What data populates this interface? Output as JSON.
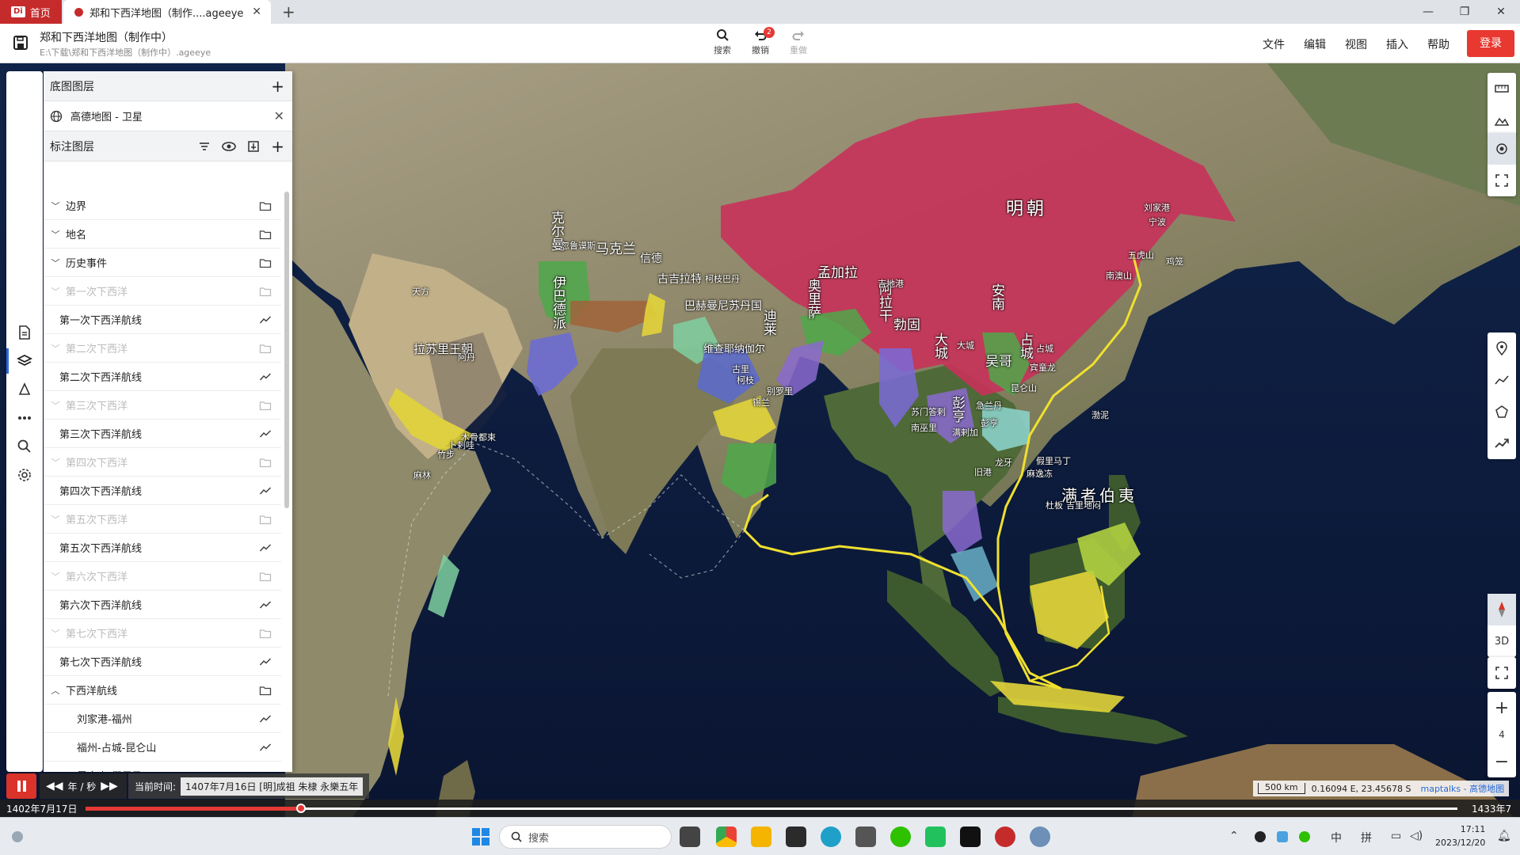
{
  "tabs": {
    "home_label": "首页",
    "home_logo": "Di",
    "doc_label": "郑和下西洋地图（制作....ageeye"
  },
  "app": {
    "title": "郑和下西洋地图（制作中）",
    "path": "E:\\下载\\郑和下西洋地图（制作中）.ageeye",
    "tools": {
      "search": "搜索",
      "undo": "撤销",
      "undo_badge": "2",
      "redo": "重做"
    },
    "menu": [
      "文件",
      "编辑",
      "视图",
      "插入",
      "帮助"
    ],
    "login": "登录"
  },
  "panel": {
    "basemap_header": "底图图层",
    "basemap_item": "高德地图 - 卫星",
    "annot_header": "标注图层",
    "layers": [
      {
        "label": "边界",
        "kind": "folder",
        "level": 0,
        "muted": false,
        "chev": "down"
      },
      {
        "label": "地名",
        "kind": "folder",
        "level": 0,
        "muted": false,
        "chev": "down"
      },
      {
        "label": "历史事件",
        "kind": "folder",
        "level": 0,
        "muted": false,
        "chev": "down"
      },
      {
        "label": "第一次下西洋",
        "kind": "folder",
        "level": 0,
        "muted": true,
        "chev": "down"
      },
      {
        "label": "第一次下西洋航线",
        "kind": "line",
        "level": 1,
        "muted": false,
        "chev": ""
      },
      {
        "label": "第二次下西洋",
        "kind": "folder",
        "level": 0,
        "muted": true,
        "chev": "down"
      },
      {
        "label": "第二次下西洋航线",
        "kind": "line",
        "level": 1,
        "muted": false,
        "chev": ""
      },
      {
        "label": "第三次下西洋",
        "kind": "folder",
        "level": 0,
        "muted": true,
        "chev": "down"
      },
      {
        "label": "第三次下西洋航线",
        "kind": "line",
        "level": 1,
        "muted": false,
        "chev": ""
      },
      {
        "label": "第四次下西洋",
        "kind": "folder",
        "level": 0,
        "muted": true,
        "chev": "down"
      },
      {
        "label": "第四次下西洋航线",
        "kind": "line",
        "level": 1,
        "muted": false,
        "chev": ""
      },
      {
        "label": "第五次下西洋",
        "kind": "folder",
        "level": 0,
        "muted": true,
        "chev": "down"
      },
      {
        "label": "第五次下西洋航线",
        "kind": "line",
        "level": 1,
        "muted": false,
        "chev": ""
      },
      {
        "label": "第六次下西洋",
        "kind": "folder",
        "level": 0,
        "muted": true,
        "chev": "down"
      },
      {
        "label": "第六次下西洋航线",
        "kind": "line",
        "level": 1,
        "muted": false,
        "chev": ""
      },
      {
        "label": "第七次下西洋",
        "kind": "folder",
        "level": 0,
        "muted": true,
        "chev": "down"
      },
      {
        "label": "第七次下西洋航线",
        "kind": "line",
        "level": 1,
        "muted": false,
        "chev": ""
      },
      {
        "label": "下西洋航线",
        "kind": "folder",
        "level": 0,
        "muted": false,
        "chev": "up"
      },
      {
        "label": "刘家港-福州",
        "kind": "line",
        "level": 2,
        "muted": false,
        "chev": ""
      },
      {
        "label": "福州-占城-昆仑山",
        "kind": "line",
        "level": 2,
        "muted": false,
        "chev": ""
      },
      {
        "label": "昆仑山-假里马丁",
        "kind": "line",
        "level": 2,
        "muted": false,
        "chev": ""
      }
    ]
  },
  "map": {
    "labels_big": [
      {
        "id": "ming",
        "text": "明朝"
      },
      {
        "id": "manzhe",
        "text": "满者伯夷"
      }
    ],
    "labels_mid": [
      {
        "id": "mengjiala",
        "text": "孟加拉"
      },
      {
        "id": "makelan",
        "text": "马克兰"
      },
      {
        "id": "xinde",
        "text": "信德"
      },
      {
        "id": "guji",
        "text": "古吉拉特"
      },
      {
        "id": "bahe",
        "text": "巴赫曼尼苏丹国"
      },
      {
        "id": "weizha",
        "text": "维查耶纳伽尔"
      },
      {
        "id": "lasu",
        "text": "拉苏里王朝"
      },
      {
        "id": "bogu",
        "text": "勃固"
      },
      {
        "id": "wuge",
        "text": "吴哥"
      }
    ],
    "labels_vert": [
      {
        "id": "keer",
        "text": "克尔曼"
      },
      {
        "id": "yiba",
        "text": "伊巴德派"
      },
      {
        "id": "duqie",
        "text": "奥里萨"
      },
      {
        "id": "dilai",
        "text": "迪莱"
      },
      {
        "id": "aquan",
        "text": "阿拉干"
      },
      {
        "id": "annan",
        "text": "安南"
      },
      {
        "id": "dacheng",
        "text": "大城"
      },
      {
        "id": "peng",
        "text": "彭亨"
      },
      {
        "id": "zhan",
        "text": "占城"
      }
    ],
    "labels_small": [
      {
        "id": "liujia",
        "text": "刘家港"
      },
      {
        "id": "ningbo",
        "text": "宁波"
      },
      {
        "id": "wuhu",
        "text": "五虎山"
      },
      {
        "id": "jilong",
        "text": "鸡笼"
      },
      {
        "id": "nanao",
        "text": "南澳山"
      },
      {
        "id": "zhancheng",
        "text": "占城"
      },
      {
        "id": "bintong",
        "text": "宾童龙"
      },
      {
        "id": "kunlun",
        "text": "昆仑山"
      },
      {
        "id": "dacheng_s",
        "text": "大城"
      },
      {
        "id": "zhidi",
        "text": "吉地港"
      },
      {
        "id": "huonuo",
        "text": "忽鲁谟斯"
      },
      {
        "id": "kalu",
        "text": "柯枝巴丹"
      },
      {
        "id": "guli",
        "text": "古里"
      },
      {
        "id": "kezhi",
        "text": "柯枝"
      },
      {
        "id": "xilan",
        "text": "锡兰"
      },
      {
        "id": "bieluo",
        "text": "别罗里"
      },
      {
        "id": "tianfang",
        "text": "天方"
      },
      {
        "id": "adan",
        "text": "阿丹"
      },
      {
        "id": "mugu",
        "text": "木骨都束"
      },
      {
        "id": "bula",
        "text": "卜剌哇"
      },
      {
        "id": "zhubu",
        "text": "竹步"
      },
      {
        "id": "malin",
        "text": "麻林"
      },
      {
        "id": "sumen",
        "text": "苏门答剌"
      },
      {
        "id": "manla",
        "text": "满剌加"
      },
      {
        "id": "jilanda",
        "text": "急兰丹"
      },
      {
        "id": "pengheng",
        "text": "彭亨"
      },
      {
        "id": "jiuzhu",
        "text": "旧港"
      },
      {
        "id": "jiali",
        "text": "假里马丁"
      },
      {
        "id": "bonei",
        "text": "渤泥"
      },
      {
        "id": "machi",
        "text": "麻逸冻"
      },
      {
        "id": "duba",
        "text": "杜板"
      },
      {
        "id": "xishi",
        "text": "吉里地闷"
      },
      {
        "id": "longya",
        "text": "龙牙"
      },
      {
        "id": "nabo",
        "text": "南巫里"
      }
    ]
  },
  "timeline": {
    "speed_label": "年 / 秒",
    "current_prefix": "当前时间:",
    "current_value": "1407年7月16日 [明]成祖 朱棣 永樂五年",
    "start": "1402年7月17日",
    "end": "1433年7月",
    "progress": 0.157
  },
  "scale": {
    "bar": "500 km",
    "coords": "0.16094 E, 23.45678 S",
    "source": "maptalks - 高德地图"
  },
  "right_controls": {
    "mode3d": "3D",
    "zoom": "4"
  },
  "taskbar": {
    "search_placeholder": "搜索",
    "ime1": "中",
    "ime2": "拼",
    "time": "17:11",
    "date": "2023/12/20"
  },
  "colors": {
    "accent": "#e8382f",
    "ming": "#c8325a",
    "route": "#f0e030",
    "ocean": "#0b1a3a"
  }
}
